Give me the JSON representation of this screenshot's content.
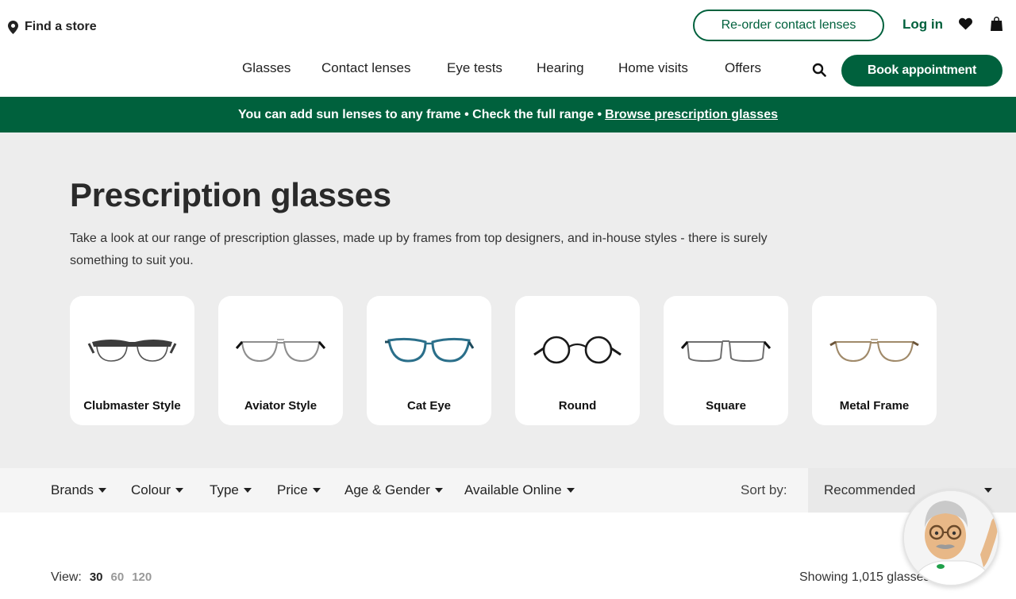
{
  "header": {
    "find_store": "Find a store",
    "reorder_label": "Re-order contact lenses",
    "login_label": "Log in",
    "book_label": "Book appointment",
    "nav": [
      "Glasses",
      "Contact lenses",
      "Eye tests",
      "Hearing",
      "Home visits",
      "Offers"
    ]
  },
  "promo": {
    "text": "You can add sun lenses to any frame • Check the full range •",
    "link": "Browse prescription glasses"
  },
  "hero": {
    "title": "Prescription glasses",
    "description": "Take a look at our range of prescription glasses, made up by frames from top designers, and in-house styles - there is surely something to suit you."
  },
  "styles": [
    {
      "label": "Clubmaster Style",
      "frame_color": "#3c3c3c"
    },
    {
      "label": "Aviator Style",
      "frame_color": "#9a9a9a"
    },
    {
      "label": "Cat Eye",
      "frame_color": "#2b6f8a"
    },
    {
      "label": "Round",
      "frame_color": "#1a1a1a"
    },
    {
      "label": "Square",
      "frame_color": "#6f6f6f"
    },
    {
      "label": "Metal Frame",
      "frame_color": "#a08a6a"
    }
  ],
  "filters": {
    "items": [
      "Brands",
      "Colour",
      "Type",
      "Price",
      "Age & Gender",
      "Available Online"
    ],
    "sort_label": "Sort by:",
    "sort_value": "Recommended"
  },
  "results": {
    "view_label": "View:",
    "view_options": [
      "30",
      "60",
      "120"
    ],
    "showing": "Showing 1,015 glasses"
  },
  "colors": {
    "brand_green": "#00613d",
    "hero_bg": "#ededed"
  }
}
